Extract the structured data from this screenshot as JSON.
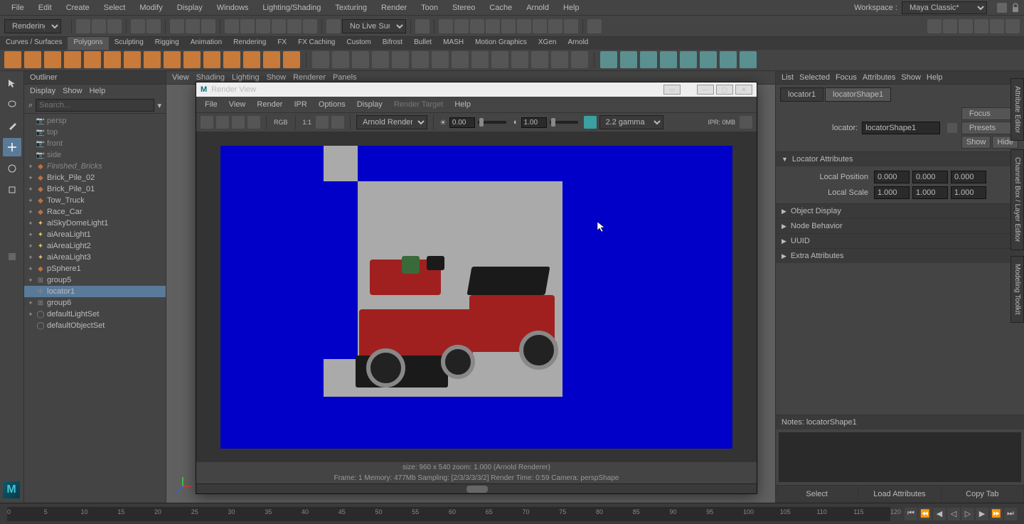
{
  "menubar": [
    "File",
    "Edit",
    "Create",
    "Select",
    "Modify",
    "Display",
    "Windows",
    "Lighting/Shading",
    "Texturing",
    "Render",
    "Toon",
    "Stereo",
    "Cache",
    "Arnold",
    "Help"
  ],
  "workspace_label": "Workspace :",
  "workspace_value": "Maya Classic*",
  "mode": "Rendering",
  "live_surface": "No Live Surface",
  "shelf_tabs": [
    "Curves / Surfaces",
    "Polygons",
    "Sculpting",
    "Rigging",
    "Animation",
    "Rendering",
    "FX",
    "FX Caching",
    "Custom",
    "Bifrost",
    "Bullet",
    "MASH",
    "Motion Graphics",
    "XGen",
    "Arnold"
  ],
  "shelf_active": 1,
  "outliner": {
    "title": "Outliner",
    "menu": [
      "Display",
      "Show",
      "Help"
    ],
    "search_placeholder": "Search...",
    "items": [
      {
        "label": "persp",
        "icon": "cam",
        "dim": true
      },
      {
        "label": "top",
        "icon": "cam",
        "dim": true
      },
      {
        "label": "front",
        "icon": "cam",
        "dim": true
      },
      {
        "label": "side",
        "icon": "cam",
        "dim": true
      },
      {
        "label": "Finished_Bricks",
        "icon": "mesh",
        "strike": true,
        "expand": "+"
      },
      {
        "label": "Brick_Pile_02",
        "icon": "mesh",
        "expand": "+"
      },
      {
        "label": "Brick_Pile_01",
        "icon": "mesh",
        "expand": "+"
      },
      {
        "label": "Tow_Truck",
        "icon": "mesh",
        "expand": "+"
      },
      {
        "label": "Race_Car",
        "icon": "mesh",
        "expand": "+"
      },
      {
        "label": "aiSkyDomeLight1",
        "icon": "light",
        "expand": "+"
      },
      {
        "label": "aiAreaLight1",
        "icon": "light",
        "expand": "+"
      },
      {
        "label": "aiAreaLight2",
        "icon": "light",
        "expand": "+"
      },
      {
        "label": "aiAreaLight3",
        "icon": "light",
        "expand": "+"
      },
      {
        "label": "pSphere1",
        "icon": "mesh",
        "expand": "+"
      },
      {
        "label": "group5",
        "icon": "group",
        "expand": "+"
      },
      {
        "label": "locator1",
        "icon": "locator",
        "selected": true
      },
      {
        "label": "group6",
        "icon": "group",
        "expand": "+"
      },
      {
        "label": "defaultLightSet",
        "icon": "set",
        "expand": "+"
      },
      {
        "label": "defaultObjectSet",
        "icon": "set"
      }
    ]
  },
  "viewport_menu": [
    "View",
    "Shading",
    "Lighting",
    "Show",
    "Renderer",
    "Panels"
  ],
  "attr": {
    "menu": [
      "List",
      "Selected",
      "Focus",
      "Attributes",
      "Show",
      "Help"
    ],
    "tabs": [
      "locator1",
      "locatorShape1"
    ],
    "active_tab": 1,
    "node_label": "locator:",
    "node_value": "locatorShape1",
    "buttons": [
      "Focus",
      "Presets",
      "Show",
      "Hide"
    ],
    "sections": [
      {
        "title": "Locator Attributes",
        "open": true,
        "fields": [
          {
            "label": "Local Position",
            "vals": [
              "0.000",
              "0.000",
              "0.000"
            ]
          },
          {
            "label": "Local Scale",
            "vals": [
              "1.000",
              "1.000",
              "1.000"
            ]
          }
        ]
      },
      {
        "title": "Object Display",
        "open": false
      },
      {
        "title": "Node Behavior",
        "open": false
      },
      {
        "title": "UUID",
        "open": false
      },
      {
        "title": "Extra Attributes",
        "open": false
      }
    ],
    "notes_label": "Notes:  locatorShape1",
    "actions": [
      "Select",
      "Load Attributes",
      "Copy Tab"
    ],
    "sidetabs": [
      "Attribute Editor",
      "Channel Box / Layer Editor",
      "Modeling Toolkit"
    ]
  },
  "render": {
    "title": "Render View",
    "menu": [
      "File",
      "View",
      "Render",
      "IPR",
      "Options",
      "Display",
      "Render Target",
      "Help"
    ],
    "rgb": "RGB",
    "ratio": "1:1",
    "renderer": "Arnold Renderer",
    "exposure": "0.00",
    "gamma_val": "1.00",
    "gamma_preset": "2.2 gamma",
    "ipr": "IPR: 0MB",
    "status1": "size: 960 x 540 zoom: 1.000     (Arnold Renderer)",
    "status2": "Frame:  1     Memory: 477Mb   Sampling: [2/3/3/3/3/2]    Render Time: 0:59    Camera: perspShape"
  },
  "timeline": {
    "ticks": [
      "0",
      "5",
      "10",
      "15",
      "20",
      "25",
      "30",
      "35",
      "40",
      "45",
      "50",
      "55",
      "60",
      "65",
      "70",
      "75",
      "80",
      "85",
      "90",
      "95",
      "100",
      "105",
      "110",
      "115",
      "120"
    ]
  }
}
